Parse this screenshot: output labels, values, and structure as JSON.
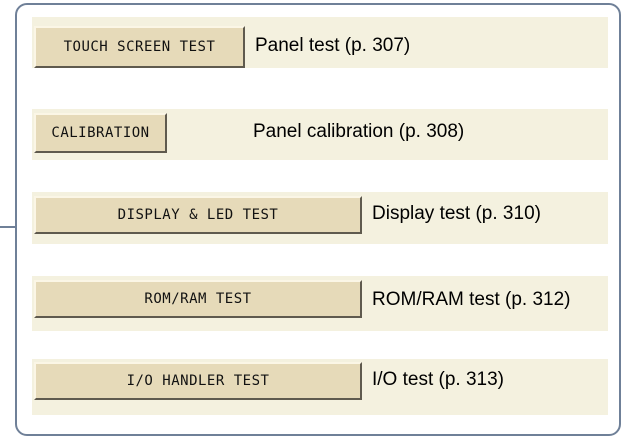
{
  "tests": [
    {
      "button_label": "TOUCH SCREEN TEST",
      "description": "Panel test (p. 307)"
    },
    {
      "button_label": "CALIBRATION",
      "description": "Panel calibration (p. 308)"
    },
    {
      "button_label": "DISPLAY & LED TEST",
      "description": "Display test (p. 310)"
    },
    {
      "button_label": "ROM/RAM TEST",
      "description": "ROM/RAM test (p. 312)"
    },
    {
      "button_label": "I/O HANDLER TEST",
      "description": "I/O test (p. 313)"
    }
  ],
  "colors": {
    "frame_border": "#6f8098",
    "band_background": "#f4f1df",
    "button_face": "#e6dab9"
  }
}
